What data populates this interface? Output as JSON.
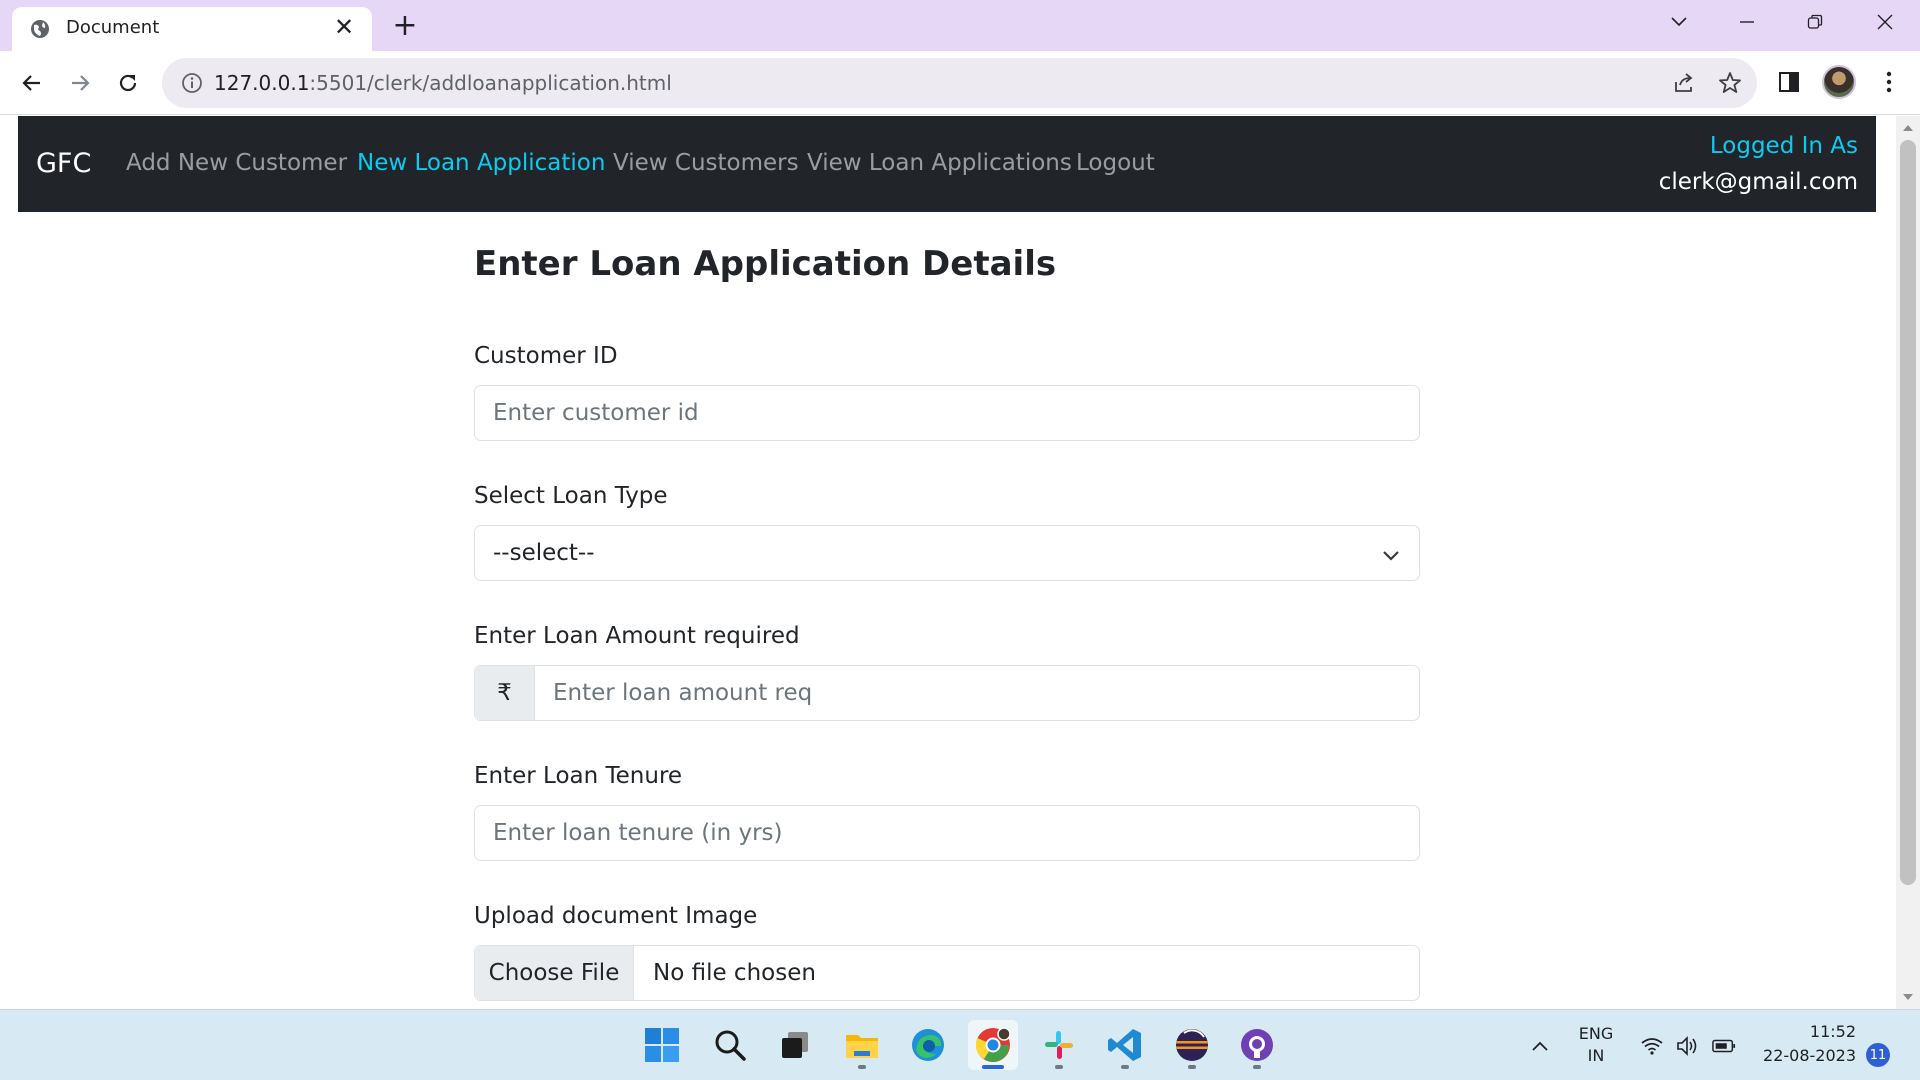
{
  "browser": {
    "tab_title": "Document",
    "url_host": "127.0.0.1",
    "url_rest": ":5501/clerk/addloanapplication.html"
  },
  "navbar": {
    "brand": "GFC",
    "links": [
      "Add New Customer",
      "New Loan Application",
      "View Customers",
      "View Loan Applications",
      "Logout"
    ],
    "active_index": 1,
    "logged_in_label": "Logged In As",
    "logged_in_user": "clerk@gmail.com"
  },
  "form": {
    "title": "Enter Loan Application Details",
    "customer_id": {
      "label": "Customer ID",
      "placeholder": "Enter customer id"
    },
    "loan_type": {
      "label": "Select Loan Type",
      "selected": "--select--"
    },
    "loan_amount": {
      "label": "Enter Loan Amount required",
      "prefix": "₹",
      "placeholder": "Enter loan amount req"
    },
    "loan_tenure": {
      "label": "Enter Loan Tenure",
      "placeholder": "Enter loan tenure (in yrs)"
    },
    "document": {
      "label": "Upload document Image",
      "button": "Choose File",
      "status": "No file chosen"
    }
  },
  "taskbar": {
    "lang_top": "ENG",
    "lang_bottom": "IN",
    "time": "11:52",
    "date": "22-08-2023",
    "notification_count": "11"
  },
  "colors": {
    "navbar_bg": "#212529",
    "accent_cyan": "#0dcaf0",
    "tabbar_bg": "#e6d7f7",
    "taskbar_bg": "#d7e9f2"
  }
}
